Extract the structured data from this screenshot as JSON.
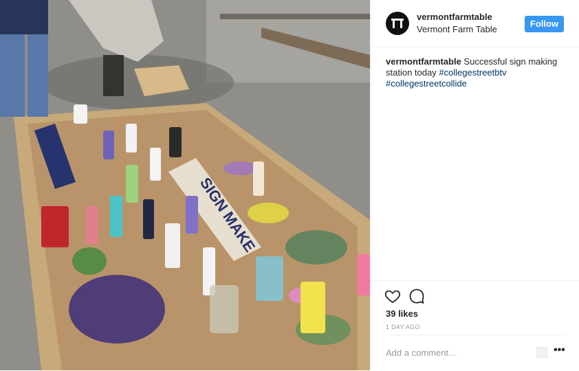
{
  "post": {
    "photo_description_name": "sign-making-station-photo",
    "sign_text": "SIGN MAKE"
  },
  "header": {
    "username": "vermontfarmtable",
    "full_name": "Vermont Farm Table",
    "follow_label": "Follow"
  },
  "caption": {
    "username": "vermontfarmtable",
    "text": " Successful sign making station today ",
    "hashtags": [
      "#collegestreetbtv",
      "#collegestreetcollide"
    ]
  },
  "actions": {
    "likes": "39 likes",
    "time": "1 DAY AGO",
    "comment_placeholder": "Add a comment…",
    "more_label": "•••"
  },
  "colors": {
    "follow_button": "#3897f0",
    "hashtag": "#003569",
    "muted": "#999999"
  },
  "icons": [
    "heart-icon",
    "comment-icon",
    "more-options-icon",
    "avatar-table-logo"
  ]
}
